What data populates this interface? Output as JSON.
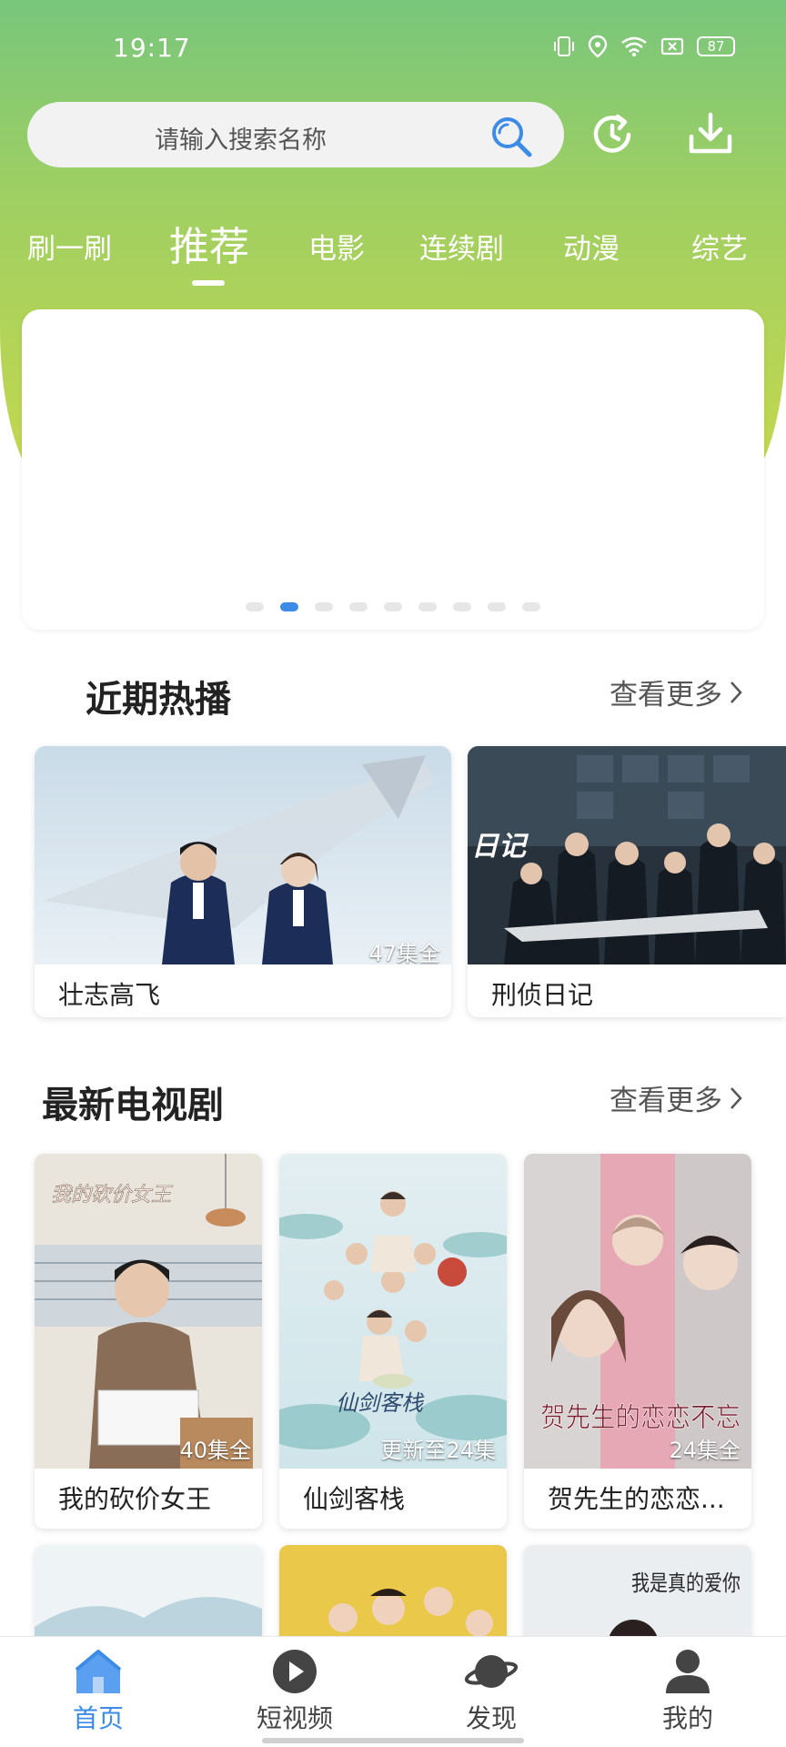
{
  "status_bar": {
    "time": "19:17",
    "battery": "87"
  },
  "search": {
    "placeholder": "请输入搜索名称"
  },
  "tabs": [
    {
      "label": "刷一刷"
    },
    {
      "label": "推荐"
    },
    {
      "label": "电影"
    },
    {
      "label": "连续剧"
    },
    {
      "label": "动漫"
    },
    {
      "label": "综艺"
    }
  ],
  "active_tab": "推荐",
  "banner": {
    "page_count": 9,
    "active_index": 1
  },
  "hot_section": {
    "title": "近期热播",
    "more_label": "查看更多",
    "items": [
      {
        "name": "壮志高飞",
        "episodes": "47集全"
      },
      {
        "name": "刑侦日记",
        "episodes": ""
      }
    ]
  },
  "tv_section": {
    "title": "最新电视剧",
    "more_label": "查看更多",
    "items": [
      {
        "name": "我的砍价女王",
        "episodes": "40集全",
        "poster_text": "我的砍价女王"
      },
      {
        "name": "仙剑客栈",
        "episodes": "更新至24集",
        "poster_text": "仙剑客栈"
      },
      {
        "name": "贺先生的恋恋...",
        "episodes": "24集全",
        "poster_text": "贺先生的恋恋不忘"
      }
    ],
    "partial_items": [
      {
        "poster_text": ""
      },
      {
        "poster_text": ""
      },
      {
        "poster_text": "我是真的爱你"
      }
    ]
  },
  "bottom_nav": [
    {
      "label": "首页",
      "icon": "home-icon"
    },
    {
      "label": "短视频",
      "icon": "play-icon"
    },
    {
      "label": "发现",
      "icon": "planet-icon"
    },
    {
      "label": "我的",
      "icon": "user-icon"
    }
  ],
  "colors": {
    "accent": "#3c8ce7",
    "header_top": "#78c67c",
    "header_bottom": "#c6d84d"
  }
}
